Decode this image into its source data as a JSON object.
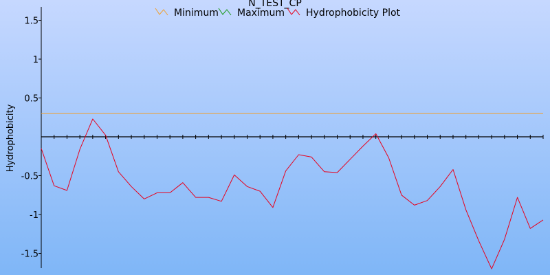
{
  "chart_data": {
    "type": "line",
    "title": "N_TEST_CP",
    "xlabel": "",
    "ylabel": "Hydrophobicity",
    "ylim": [
      -1.68,
      1.68
    ],
    "xlim": [
      0,
      39
    ],
    "grid": false,
    "legend_position": "top-center",
    "y_ticks": [
      {
        "value": 1.5,
        "label": "1.5"
      },
      {
        "value": 1,
        "label": "1"
      },
      {
        "value": 0.5,
        "label": "0.5"
      },
      {
        "value": -0.5,
        "label": "-0.5"
      },
      {
        "value": -1,
        "label": "-1"
      },
      {
        "value": -1.5,
        "label": "-1.5"
      }
    ],
    "series": [
      {
        "name": "Minimum",
        "color": "#f0a030",
        "style": "hline",
        "values": [
          0.3
        ]
      },
      {
        "name": "Maximum",
        "color": "#1a9a1a",
        "style": "hline",
        "values": []
      },
      {
        "name": "Hydrophobicity Plot",
        "color": "#e8001c",
        "style": "line",
        "values": [
          -0.15,
          -0.63,
          -0.69,
          -0.16,
          0.23,
          0.02,
          -0.45,
          -0.64,
          -0.8,
          -0.72,
          -0.72,
          -0.59,
          -0.78,
          -0.78,
          -0.83,
          -0.49,
          -0.64,
          -0.7,
          -0.91,
          -0.44,
          -0.23,
          -0.26,
          -0.45,
          -0.46,
          -0.29,
          -0.12,
          0.04,
          -0.27,
          -0.75,
          -0.88,
          -0.82,
          -0.64,
          -0.42,
          -0.94,
          -1.34,
          -1.7,
          -1.32,
          -0.78,
          -1.18,
          -1.07
        ]
      }
    ]
  },
  "colors": {
    "background_top": "#c6d8ff",
    "background_bottom": "#7fb6f7",
    "axis": "#000000"
  }
}
